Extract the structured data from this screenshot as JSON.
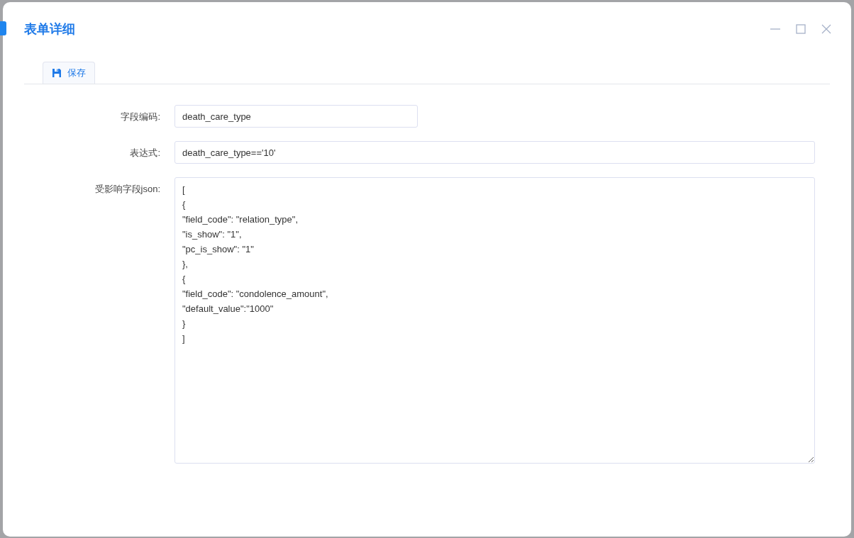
{
  "dialog": {
    "title": "表单详细"
  },
  "toolbar": {
    "buttons": [
      {
        "kind": "save",
        "label": "保存"
      }
    ]
  },
  "form": {
    "fields": [
      {
        "kind": "input",
        "label": "字段编码:",
        "value": "death_care_type",
        "wide": false
      },
      {
        "kind": "input",
        "label": "表达式:",
        "value": "death_care_type=='10'",
        "wide": true
      },
      {
        "kind": "textarea",
        "label": "受影响字段json:",
        "value": "[\n{\n\"field_code\": \"relation_type\",\n\"is_show\": \"1\",\n\"pc_is_show\": \"1\"\n},\n{\n\"field_code\": \"condolence_amount\",\n\"default_value\":\"1000\"\n}\n]"
      }
    ]
  }
}
